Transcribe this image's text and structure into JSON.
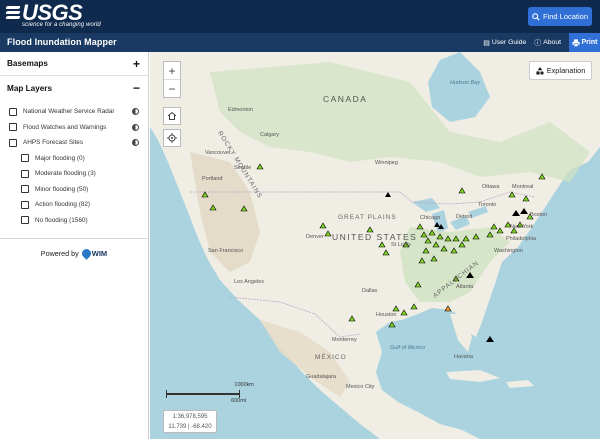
{
  "header": {
    "logo_text": "USGS",
    "logo_tagline": "science for a changing world",
    "find_location_label": "Find Location"
  },
  "subheader": {
    "app_title": "Flood Inundation Mapper",
    "user_guide_label": "User Guide",
    "about_label": "About",
    "print_label": "Print"
  },
  "sidebar": {
    "basemaps_label": "Basemaps",
    "basemaps_toggle": "+",
    "map_layers_label": "Map Layers",
    "map_layers_toggle": "−",
    "layers": [
      {
        "label": "National Weather Service Radar"
      },
      {
        "label": "Flood Watches and Warnings"
      },
      {
        "label": "AHPS Forecast Sites"
      }
    ],
    "sublayers": [
      {
        "label": "Major flooding (0)"
      },
      {
        "label": "Moderate flooding (3)"
      },
      {
        "label": "Minor flooding (50)"
      },
      {
        "label": "Action flooding (82)"
      },
      {
        "label": "No flooding (1560)"
      }
    ],
    "powered_by_label": "Powered by",
    "powered_by_brand": "WIM"
  },
  "map": {
    "explanation_label": "Explanation",
    "zoom_in": "+",
    "zoom_out": "−",
    "scale_km": "1000km",
    "scale_mi": "600mi",
    "scale_ratio": "1:36,978,595",
    "cursor_coords": "11.739 | -68.420",
    "labels": {
      "canada": "CANADA",
      "united_states": "UNITED STATES",
      "great_plains": "GREAT PLAINS",
      "mexico": "MÉXICO",
      "rocky_mountains": "ROCKY MOUNTAINS",
      "appalachian": "APPALACHIAN",
      "gulf": "Gulf of Mexico",
      "hudson": "Hudson Bay",
      "edmonton": "Edmonton",
      "calgary": "Calgary",
      "vancouver": "Vancouver",
      "seattle": "Seattle",
      "portland": "Portland",
      "san_francisco": "San Francisco",
      "los_angeles": "Los Angeles",
      "denver": "Denver",
      "dallas": "Dallas",
      "houston": "Houston",
      "st_louis": "St Louis",
      "chicago": "Chicago",
      "detroit": "Detroit",
      "toronto": "Toronto",
      "ottawa": "Ottawa",
      "montreal": "Montreal",
      "boston": "Boston",
      "new_york": "New York",
      "philadelphia": "Philadelphia",
      "washington": "Washington",
      "atlanta": "Atlanta",
      "havana": "Havana",
      "monterrey": "Monterrey",
      "guadalajara": "Guadalajara",
      "mexico_city": "Mexico City",
      "winnipeg": "Winnipeg"
    }
  },
  "colors": {
    "header_bg": "#0f2a4d",
    "subheader_bg": "#1b3a63",
    "accent": "#2f6fd6",
    "land": "#f0ede4",
    "water": "#aad3df",
    "site_action": "#7ed321",
    "site_none": "#000000"
  }
}
